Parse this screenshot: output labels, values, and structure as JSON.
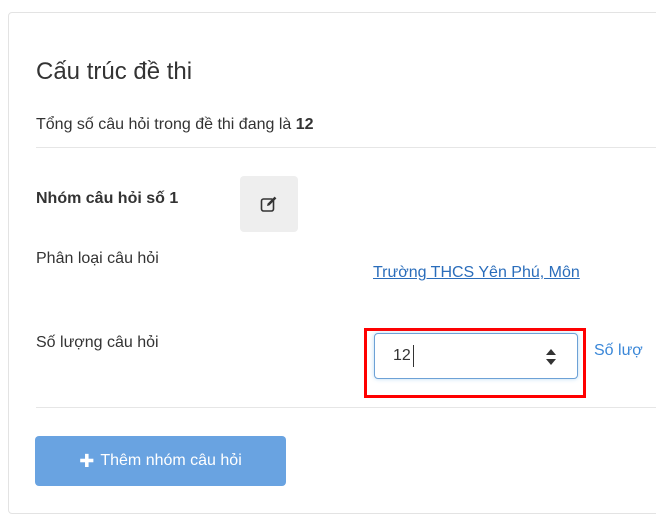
{
  "page": {
    "title": "Cấu trúc đề thi",
    "summary_prefix": "Tổng số câu hỏi trong đề thi đang là ",
    "summary_count": "12"
  },
  "group": {
    "title": "Nhóm câu hỏi số 1",
    "edit_icon": "edit-icon",
    "category_label": "Phân loại câu hỏi",
    "category_link": "Trường THCS Yên Phú, Môn",
    "quantity_label": "Số lượng câu hỏi",
    "quantity_value": "12",
    "quantity_hint": "Số lượ"
  },
  "actions": {
    "add_group_label": "Thêm nhóm câu hỏi",
    "add_group_icon": "plus-icon"
  },
  "colors": {
    "link": "#2a6dbb",
    "button_bg": "#69a3e1",
    "highlight": "#ff0000"
  }
}
